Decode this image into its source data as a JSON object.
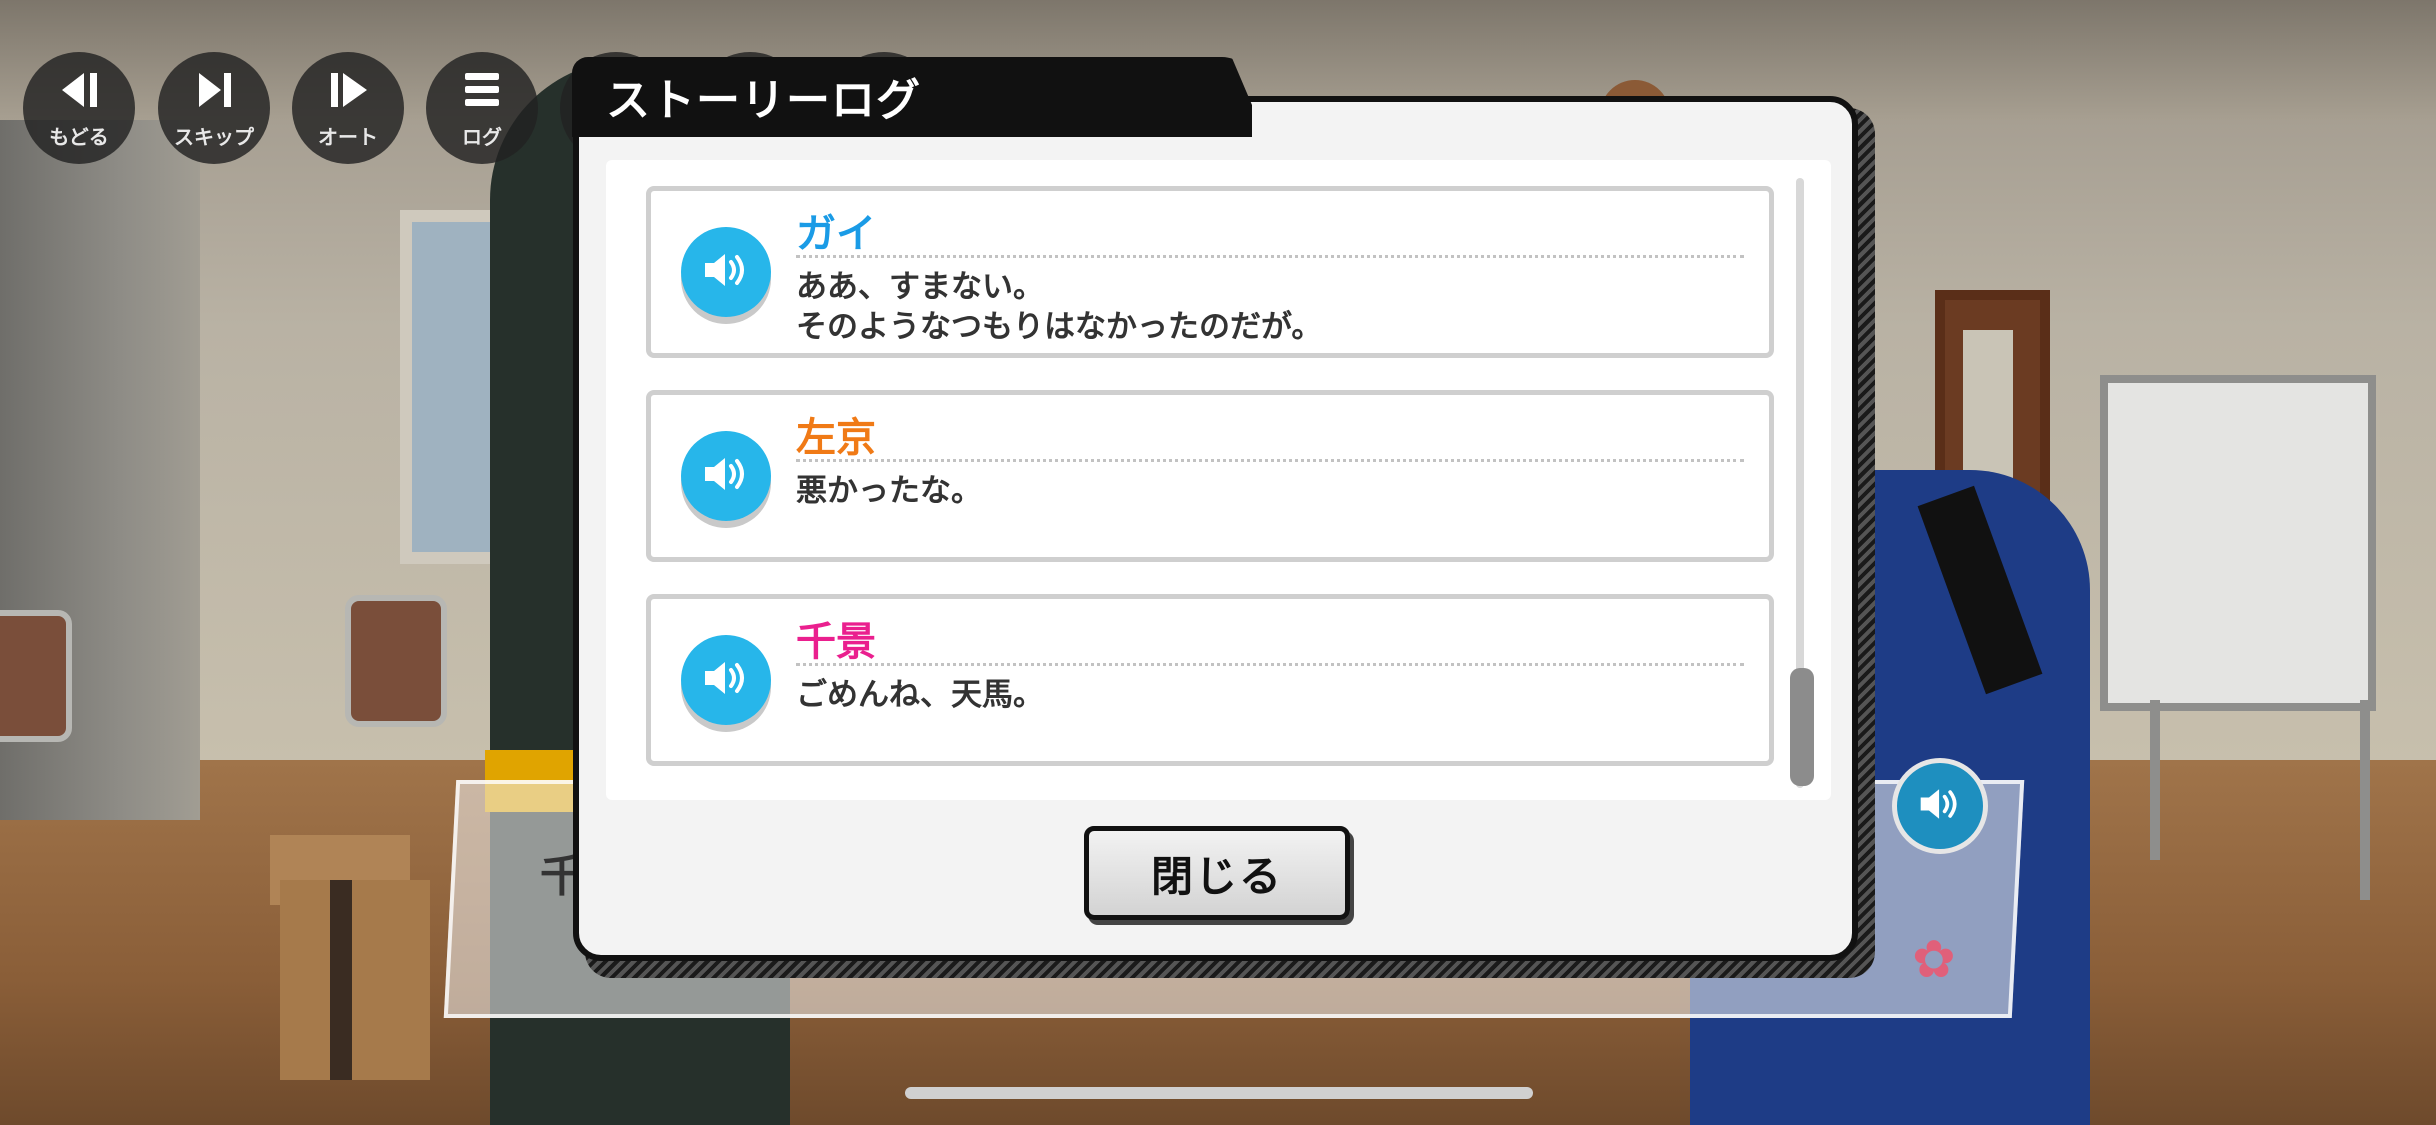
{
  "toolbar": {
    "buttons": [
      {
        "label": "もどる",
        "icon": "back-icon"
      },
      {
        "label": "スキップ",
        "icon": "skip-icon"
      },
      {
        "label": "オート",
        "icon": "auto-play-icon"
      },
      {
        "label": "ログ",
        "icon": "menu-list-icon"
      }
    ]
  },
  "dialog": {
    "title": "ストーリーログ",
    "close_label": "閉じる",
    "entries": [
      {
        "speaker": "ガイ",
        "color": "#1a9be6",
        "text": "ああ、すまない。\nそのようなつもりはなかったのだが。"
      },
      {
        "speaker": "左京",
        "color": "#f07a16",
        "text": "悪かったな。"
      },
      {
        "speaker": "千景",
        "color": "#ea1f8e",
        "text": "ごめんね、天馬。"
      }
    ]
  },
  "background": {
    "message_name_fragment": "千"
  },
  "colors": {
    "voice_button": "#27b6ea",
    "dialog_border": "#111111"
  }
}
